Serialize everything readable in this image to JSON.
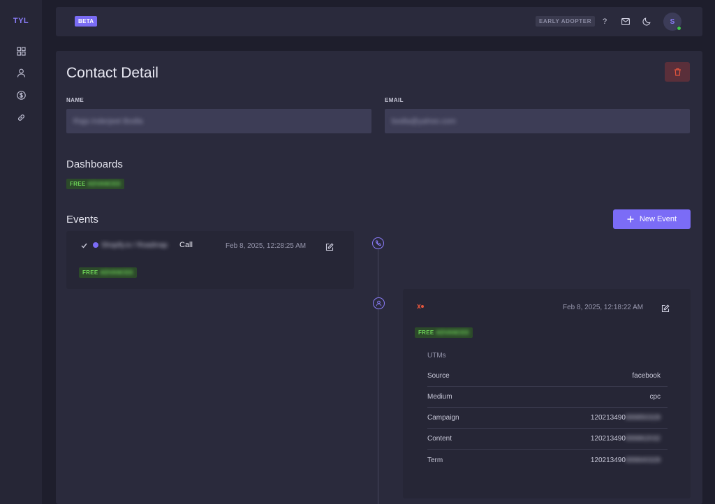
{
  "sidebar": {
    "logo": "TYL",
    "icons": [
      "grid-icon",
      "user-icon",
      "dollar-icon",
      "link-icon"
    ]
  },
  "topbar": {
    "beta_label": "BETA",
    "early_adopter_label": "EARLY ADOPTER",
    "help_label": "?",
    "avatar_initial": "S"
  },
  "page": {
    "title": "Contact Detail"
  },
  "form": {
    "name_label": "NAME",
    "name_value": "Raja Inderjeet Bodla",
    "email_label": "EMAIL",
    "email_value": "bodla@yahoo.com"
  },
  "dashboards": {
    "title": "Dashboards",
    "badge_label": "FREE",
    "badge_hidden": "ADVANCED"
  },
  "events": {
    "title": "Events",
    "new_event_label": "New Event",
    "items": [
      {
        "title_hidden": "Shopify.io / Roadmap",
        "title_suffix": "Call",
        "time": "Feb 8, 2025, 12:28:25 AM",
        "badge_label": "FREE",
        "badge_hidden": "ADVANCED"
      },
      {
        "time": "Feb 8, 2025, 12:18:22 AM",
        "badge_label": "FREE",
        "badge_hidden": "ADVANCED",
        "utms_title": "UTMs",
        "utms": [
          {
            "key": "Source",
            "value": "facebook",
            "hidden": ""
          },
          {
            "key": "Medium",
            "value": "cpc",
            "hidden": ""
          },
          {
            "key": "Campaign",
            "value": "120213490",
            "hidden": "899850328"
          },
          {
            "key": "Content",
            "value": "120213490",
            "hidden": "899862032"
          },
          {
            "key": "Term",
            "value": "120213490",
            "hidden": "899840328"
          }
        ]
      }
    ]
  },
  "colors": {
    "accent": "#7b6cf6",
    "background": "#1e1e2c",
    "card": "#2a2a3c",
    "badge_green": "#6ed458",
    "danger": "#e2553d"
  }
}
